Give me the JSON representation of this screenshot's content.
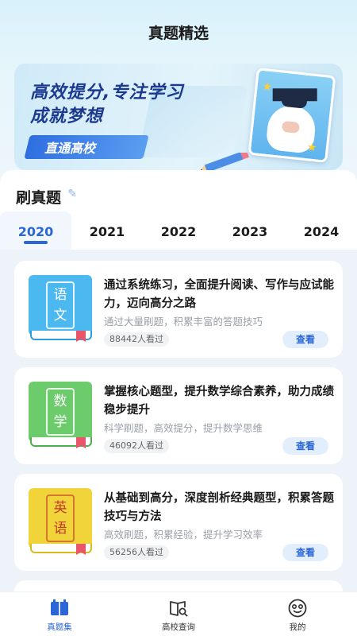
{
  "header": {
    "title": "真题精选"
  },
  "banner": {
    "line1": "高效提分,专注学习",
    "line2": "成就梦想",
    "cta": "直通高校"
  },
  "section": {
    "title": "刷真题"
  },
  "years": [
    "2020",
    "2021",
    "2022",
    "2023",
    "2024"
  ],
  "active_year": "2020",
  "cards": [
    {
      "subject_line1": "语",
      "subject_line2": "文",
      "color": "#4cb8f0",
      "pages_color": "#2f9bd8",
      "headline": "通过系统练习，全面提升阅读、写作与应试能力，迈向高分之路",
      "desc": "通过大量刷题，积累丰富的答题技巧",
      "views": "88442人看过",
      "button": "查看"
    },
    {
      "subject_line1": "数",
      "subject_line2": "学",
      "color": "#6ccb6a",
      "pages_color": "#4fae4e",
      "headline": "掌握核心题型，提升数学综合素养，助力成绩稳步提升",
      "desc": "科学刷题，高效提分，提升数学思维",
      "views": "46092人看过",
      "button": "查看"
    },
    {
      "subject_line1": "英",
      "subject_line2": "语",
      "color": "#f1d43a",
      "pages_color": "#d8ba1f",
      "headline": "从基础到高分，深度剖析经典题型，积累答题技巧与方法",
      "desc": "高效刷题，积累经验，提升学习效率",
      "views": "56256人看过",
      "button": "查看"
    }
  ],
  "nav": [
    {
      "label": "真题集",
      "icon": "book-open-icon",
      "active": true
    },
    {
      "label": "高校查询",
      "icon": "book-search-icon",
      "active": false
    },
    {
      "label": "我的",
      "icon": "smile-face-icon",
      "active": false
    }
  ],
  "colors": {
    "accent": "#2a66d6",
    "banner_text": "#1b3a8f"
  }
}
